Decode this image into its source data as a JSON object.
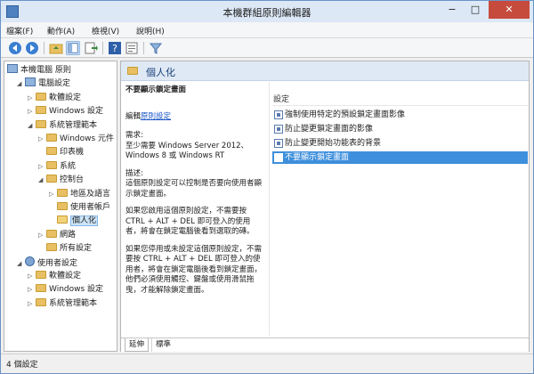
{
  "window": {
    "title": "本機群組原則編輯器",
    "minimize": "−",
    "maximize": "□",
    "close": "✕"
  },
  "menubar": [
    "檔案(F)",
    "動作(A)",
    "檢視(V)",
    "說明(H)"
  ],
  "toolbar": [
    "back-icon",
    "forward-icon",
    "up-folder-icon",
    "show-hide-tree-icon",
    "export-list-icon",
    "help-icon",
    "properties-icon",
    "filter-icon"
  ],
  "tree": {
    "root": "本機電腦 原則",
    "items": [
      {
        "label": "電腦設定",
        "indent": 1,
        "icon": "computer",
        "exp": "◢"
      },
      {
        "label": "軟體設定",
        "indent": 2,
        "icon": "folder",
        "exp": "▷"
      },
      {
        "label": "Windows 設定",
        "indent": 2,
        "icon": "folder",
        "exp": "▷"
      },
      {
        "label": "系統管理範本",
        "indent": 2,
        "icon": "folder",
        "exp": "◢"
      },
      {
        "label": "Windows 元件",
        "indent": 3,
        "icon": "folder",
        "exp": "▷"
      },
      {
        "label": "印表機",
        "indent": 3,
        "icon": "folder",
        "exp": ""
      },
      {
        "label": "系統",
        "indent": 3,
        "icon": "folder",
        "exp": "▷"
      },
      {
        "label": "控制台",
        "indent": 3,
        "icon": "folder",
        "exp": "◢"
      },
      {
        "label": "地區及語言",
        "indent": 4,
        "icon": "folder",
        "exp": "▷"
      },
      {
        "label": "使用者帳戶",
        "indent": 4,
        "icon": "folder",
        "exp": ""
      },
      {
        "label": "個人化",
        "indent": 4,
        "icon": "folder",
        "exp": "",
        "selected": true
      },
      {
        "label": "網路",
        "indent": 3,
        "icon": "folder",
        "exp": "▷"
      },
      {
        "label": "所有設定",
        "indent": 3,
        "icon": "folder",
        "exp": ""
      },
      {
        "label": "使用者設定",
        "indent": 1,
        "icon": "user",
        "exp": "◢"
      },
      {
        "label": "軟體設定",
        "indent": 2,
        "icon": "folder",
        "exp": "▷"
      },
      {
        "label": "Windows 設定",
        "indent": 2,
        "icon": "folder",
        "exp": "▷"
      },
      {
        "label": "系統管理範本",
        "indent": 2,
        "icon": "folder",
        "exp": "▷"
      }
    ]
  },
  "right": {
    "header": "個人化",
    "desc": {
      "title": "不要顯示鎖定畫面",
      "edit_prefix": "編輯",
      "edit_link": "原則設定",
      "req_label": "需求:",
      "req_text": "至少需要 Windows Server 2012、Windows 8 或 Windows RT",
      "desc_label": "描述:",
      "desc_text": "這個原則設定可以控制是否要向使用者顯示鎖定畫面。",
      "p_enabled": "如果您啟用這個原則設定，不需要按 CTRL + ALT + DEL 即可登入的使用者，將會在鎖定電腦後看到選取的磚。",
      "p_disabled": "如果您停用或未設定這個原則設定，不需要按 CTRL + ALT + DEL 即可登入的使用者，將會在鎖定電腦後看到鎖定畫面，他們必須使用觸控、鍵盤或使用滑鼠拖曳，才能解除鎖定畫面。"
    },
    "column": "設定",
    "rows": [
      {
        "label": "強制使用特定的預設鎖定畫面影像",
        "active": false
      },
      {
        "label": "防止變更鎖定畫面的影像",
        "active": false
      },
      {
        "label": "防止變更開始功能表的背景",
        "active": false
      },
      {
        "label": "不要顯示鎖定畫面",
        "active": true
      }
    ],
    "tabs": [
      "延伸",
      "標準"
    ]
  },
  "status": "4 個設定",
  "colors": {
    "accent": "#3e8fdc",
    "header_band": "#dfe9f5",
    "close": "#c74b3c"
  }
}
